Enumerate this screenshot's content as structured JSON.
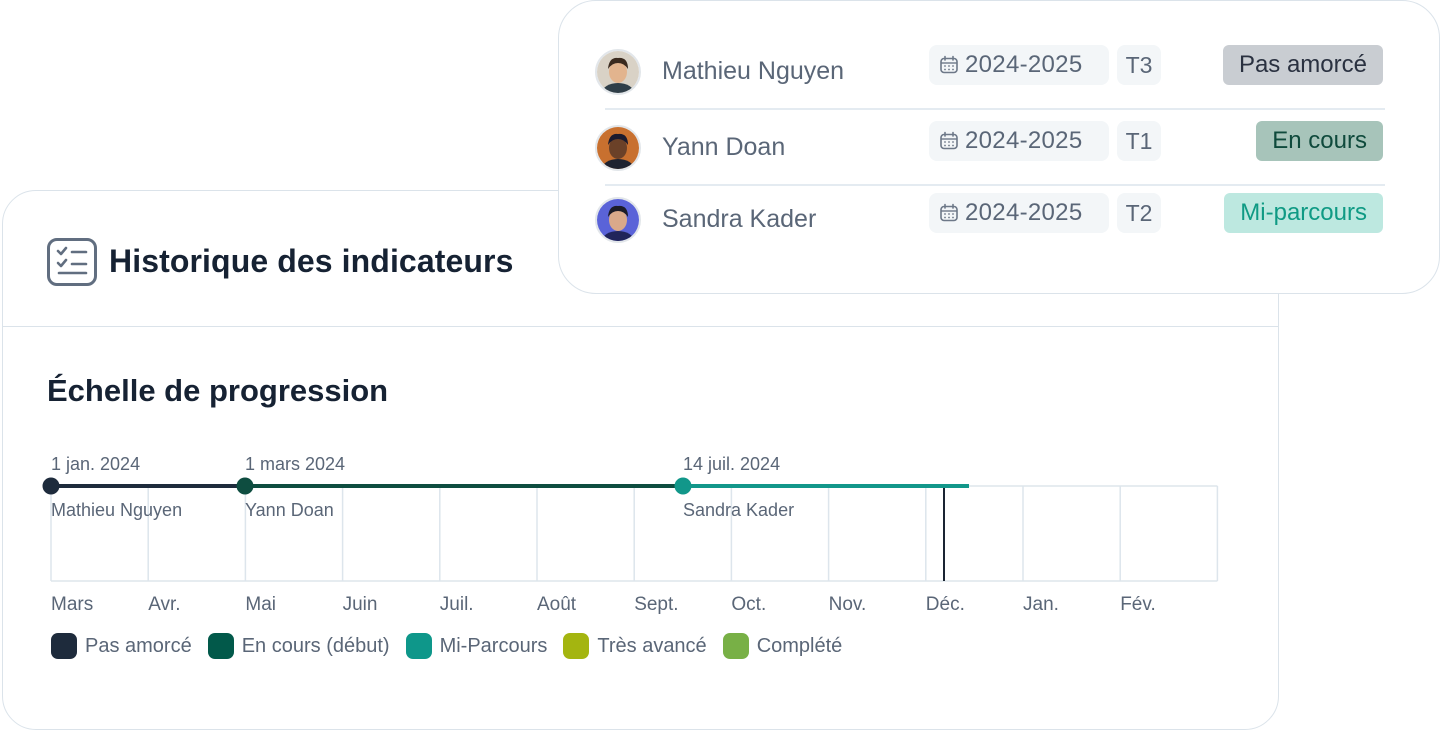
{
  "main": {
    "title": "Historique des indicateurs",
    "section_title": "Échelle de progression"
  },
  "people_list": [
    {
      "name": "Mathieu Nguyen",
      "year": "2024-2025",
      "term": "T3",
      "status": "Pas amorcé",
      "status_bg": "#c9cdd2",
      "status_fg": "#2a3140"
    },
    {
      "name": "Yann Doan",
      "year": "2024-2025",
      "term": "T1",
      "status": "En cours",
      "status_bg": "#a7c4ba",
      "status_fg": "#0f4a3c"
    },
    {
      "name": "Sandra Kader",
      "year": "2024-2025",
      "term": "T2",
      "status": "Mi-parcours",
      "status_bg": "#bde8e0",
      "status_fg": "#0f9a84"
    }
  ],
  "timeline": {
    "months": [
      "Mars",
      "Avr.",
      "Mai",
      "Juin",
      "Juil.",
      "Août",
      "Sept.",
      "Oct.",
      "Nov.",
      "Déc.",
      "Jan.",
      "Fév."
    ],
    "events": [
      {
        "date": "1 jan. 2024",
        "name": "Mathieu Nguyen",
        "color": "#1e2b3c"
      },
      {
        "date": "1 mars 2024",
        "name": "Yann Doan",
        "color": "#0e4d40"
      },
      {
        "date": "14 juil. 2024",
        "name": "Sandra Kader",
        "color": "#12978a"
      }
    ]
  },
  "legend": [
    {
      "label": "Pas amorcé",
      "color": "#1e2b3c"
    },
    {
      "label": "En cours (début)",
      "color": "#02594a"
    },
    {
      "label": "Mi-Parcours",
      "color": "#0e978a"
    },
    {
      "label": "Très avancé",
      "color": "#a4b510"
    },
    {
      "label": "Complété",
      "color": "#78b046"
    }
  ]
}
